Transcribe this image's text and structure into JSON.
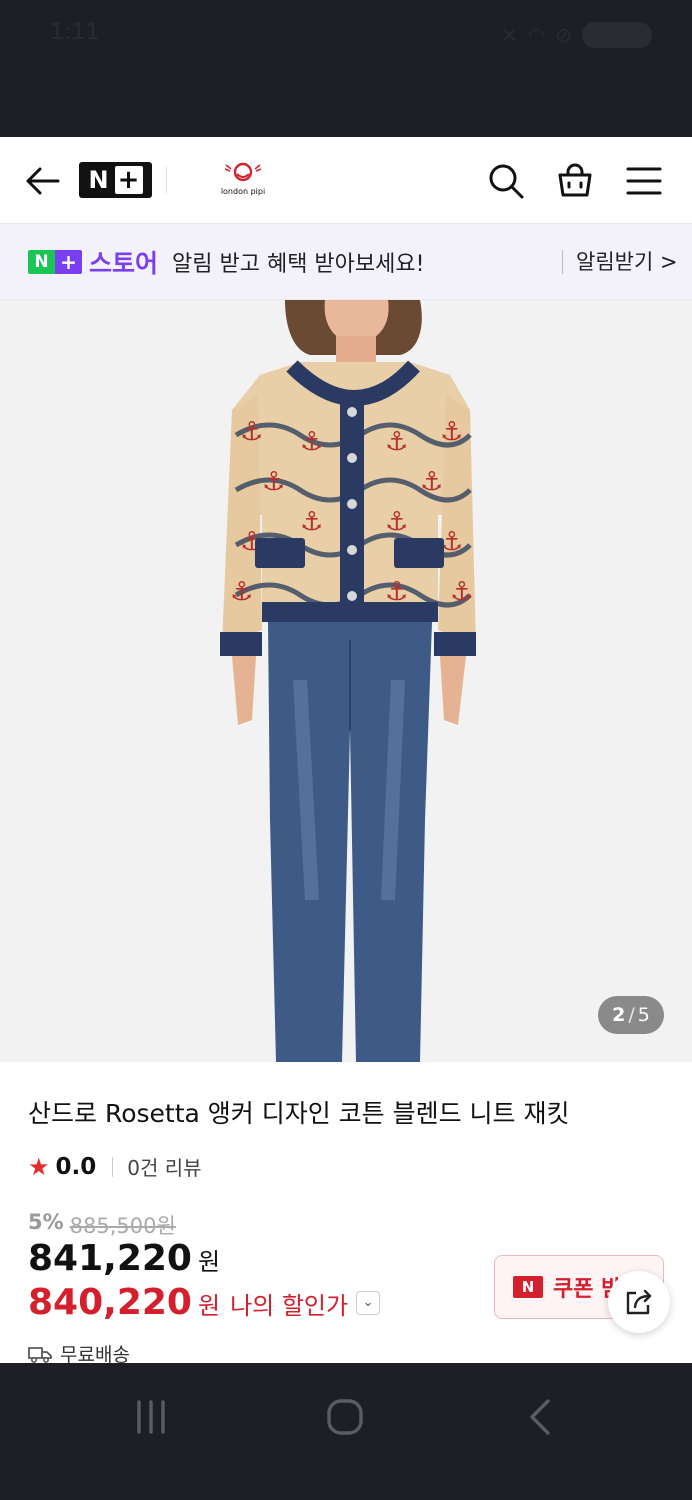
{
  "status": {
    "time": "1:11"
  },
  "header": {
    "nplus_letter": "N",
    "nplus_plus": "+",
    "brand_mark": "ᐡ",
    "brand_name": "london pipi"
  },
  "banner": {
    "badge_n": "N",
    "badge_plus": "+",
    "store": "스토어",
    "message": "알림 받고 혜택 받아보세요!",
    "cta": "알림받기 >"
  },
  "gallery": {
    "current": "2",
    "slash": "/",
    "total": "5"
  },
  "product": {
    "title": "산드로 Rosetta 앵커 디자인 코튼 블렌드 니트 재킷",
    "rating": "0.0",
    "reviews": "0건 리뷰",
    "discount_pct": "5%",
    "original_price": "885,500원",
    "price": "841,220",
    "price_unit": "원",
    "my_price": "840,220",
    "my_price_unit": "원",
    "my_price_label": "나의 할인가",
    "shipping": "무료배송"
  },
  "coupon": {
    "icon_text": "N",
    "label": "쿠폰 받기"
  },
  "colors": {
    "accent_purple": "#7b3ff2",
    "naver_green": "#19c553",
    "sale_red": "#d41f2c"
  }
}
